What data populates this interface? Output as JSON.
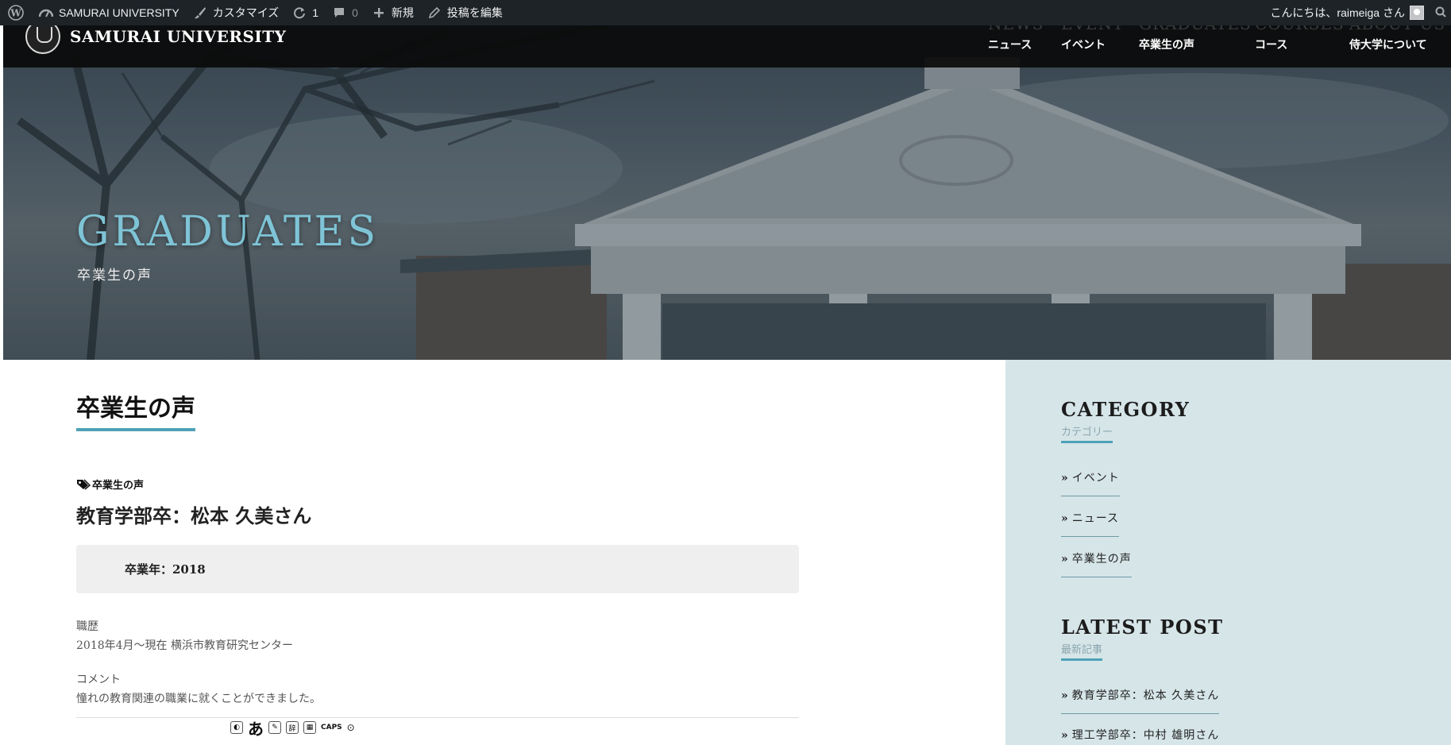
{
  "adminbar": {
    "site_name": "SAMURAI UNIVERSITY",
    "customize": "カスタマイズ",
    "updates_count": "1",
    "comments_count": "0",
    "new_label": "新規",
    "edit_post": "投稿を編集",
    "greeting": "こんにちは、raimeiga さん"
  },
  "header": {
    "site_title": "SAMURAI UNIVERSITY",
    "nav": [
      {
        "en": "NEWS",
        "ja": "ニュース"
      },
      {
        "en": "EVENT",
        "ja": "イベント"
      },
      {
        "en": "GRADUATES",
        "ja": "卒業生の声"
      },
      {
        "en": "COURSES",
        "ja": "コース"
      },
      {
        "en": "ABOUT US",
        "ja": "侍大学について"
      }
    ]
  },
  "hero": {
    "title": "GRADUATES",
    "subtitle": "卒業生の声"
  },
  "main": {
    "heading": "卒業生の声",
    "post": {
      "category": "卒業生の声",
      "title": "教育学部卒：松本 久美さん",
      "graduation_year": "卒業年：2018",
      "career_label": "職歴",
      "career_value": "2018年4月〜現在 横浜市教育研究センター",
      "comment_label": "コメント",
      "comment_value": "憧れの教育関連の職業に就くことができました。"
    },
    "ime": {
      "kana": "あ",
      "caps": "CAPS"
    }
  },
  "sidebar": {
    "category": {
      "title": "CATEGORY",
      "subtitle": "カテゴリー",
      "items": [
        "イベント",
        "ニュース",
        "卒業生の声"
      ]
    },
    "latest": {
      "title": "LATEST POST",
      "subtitle": "最新記事",
      "items": [
        "教育学部卒：松本 久美さん",
        "理工学部卒：中村 雄明さん"
      ]
    }
  },
  "colors": {
    "accent": "#4ea1b7",
    "hero_title": "#7ec4d6",
    "sidebar_bg": "#d6e5e8",
    "adminbar_bg": "#1d2327"
  }
}
